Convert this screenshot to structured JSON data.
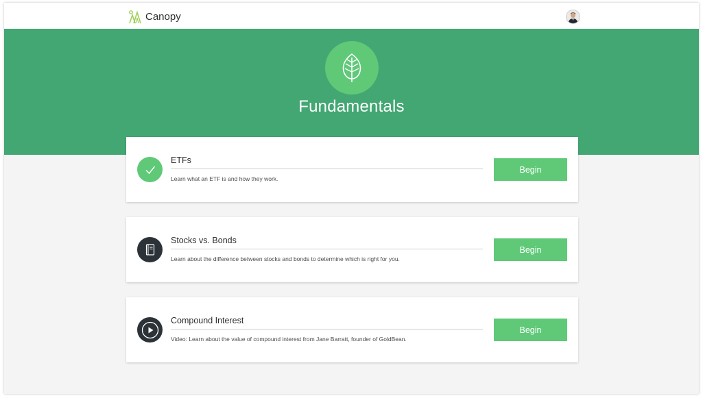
{
  "app": {
    "name": "Canopy"
  },
  "hero": {
    "title": "Fundamentals",
    "icon": "leaf-icon"
  },
  "colors": {
    "hero_background": "#43a773",
    "accent_green": "#5fc978",
    "dark_icon": "#2b3238",
    "page_background": "#f4f4f4"
  },
  "lessons": [
    {
      "title": "ETFs",
      "description": "Learn what an ETF is and how they work.",
      "icon": "checkmark-icon",
      "status": "completed",
      "button_label": "Begin"
    },
    {
      "title": "Stocks vs. Bonds",
      "description": "Learn about the difference between stocks and bonds to determine which is right for you.",
      "icon": "book-icon",
      "status": "not-started",
      "button_label": "Begin"
    },
    {
      "title": "Compound Interest",
      "description": "Video: Learn about the value of compound interest from Jane Barratt, founder of GoldBean.",
      "icon": "play-icon",
      "status": "not-started",
      "button_label": "Begin"
    }
  ]
}
